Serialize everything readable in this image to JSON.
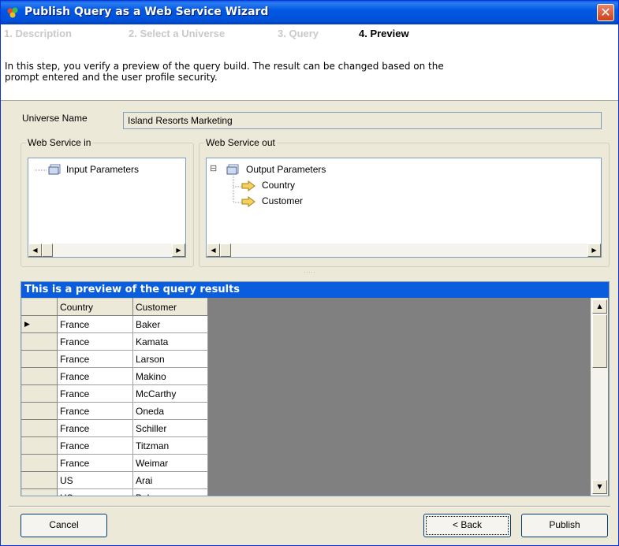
{
  "window": {
    "title": "Publish Query as a Web Service Wizard",
    "close_glyph": "✕"
  },
  "steps": [
    {
      "label": "1. Description",
      "active": false
    },
    {
      "label": "2. Select a Universe",
      "active": false
    },
    {
      "label": "3. Query",
      "active": false
    },
    {
      "label": "4. Preview",
      "active": true
    }
  ],
  "description": "In this step, you verify a preview of the query build. The result can be changed based on the prompt entered and the user profile security.",
  "universe": {
    "label": "Universe Name",
    "value": "Island Resorts Marketing"
  },
  "web_service_in": {
    "legend": "Web Service in",
    "root": "Input Parameters"
  },
  "web_service_out": {
    "legend": "Web Service out",
    "root": "Output Parameters",
    "expander": "⊟",
    "children": [
      "Country",
      "Customer"
    ]
  },
  "preview": {
    "title": "This is a preview of the query results",
    "columns": [
      "Country",
      "Customer"
    ],
    "rows": [
      [
        "France",
        "Baker"
      ],
      [
        "France",
        "Kamata"
      ],
      [
        "France",
        "Larson"
      ],
      [
        "France",
        "Makino"
      ],
      [
        "France",
        "McCarthy"
      ],
      [
        "France",
        "Oneda"
      ],
      [
        "France",
        "Schiller"
      ],
      [
        "France",
        "Titzman"
      ],
      [
        "France",
        "Weimar"
      ],
      [
        "US",
        "Arai"
      ],
      [
        "US",
        "Bel"
      ]
    ],
    "current_row_marker": "▶"
  },
  "buttons": {
    "cancel": "Cancel",
    "back": "< Back",
    "publish": "Publish"
  },
  "colors": {
    "titlebar": "#0058e3",
    "preview_header": "#0a5ede",
    "grid_background": "#808080"
  }
}
